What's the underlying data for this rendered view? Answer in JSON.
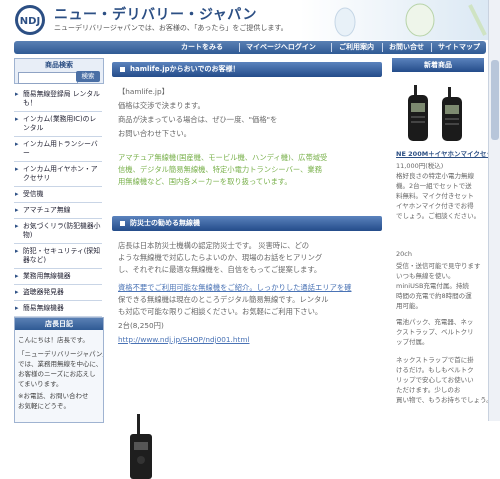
{
  "header": {
    "logo_text": "NDJ",
    "title": "ニュー・デリバリー・ジャパン",
    "tagline": "ニューデリバリージャパンでは、お客様の、「あったら」をご提供します。"
  },
  "nav": [
    "カートをみる",
    "マイページへログイン",
    "ご利用案内",
    "お問い合せ",
    "サイトマップ"
  ],
  "search": {
    "title": "商品検索",
    "button": "検索",
    "placeholder": ""
  },
  "categories": [
    "簡易無線登録局 レンタルも！",
    "インカム(業務用IC)のレンタル",
    "インカム用トランシーバー",
    "インカム用イヤホン・アクセサリ",
    "受信機",
    "アマチュア無線",
    "お気づくリラ(防犯機器小物)",
    "防犯・セキュリティ(探知器など)",
    "業務用無線機器",
    "盗聴器発見器",
    "簡易無線機器"
  ],
  "diary": {
    "title": "店長日記",
    "lines": [
      "こんにちは！店長です。",
      "「ニューデリバリージャパン」",
      "では、業務用無線を中心に、",
      "お客様のニーズにお応えし",
      "てまいります。",
      "※お電話、お問い合わせ",
      "お気軽にどうぞ。"
    ]
  },
  "welcome": {
    "heading": "hamlife.jpからおいでのお客様！",
    "lines": [
      "【hamlife.jp】",
      "価格は交渉で決まります。",
      "商品が決まっている場合は、ぜひ一度、\"価格\"を",
      "お問い合わせ下さい。",
      "アマチュア無線機(国産機、モービル機、ハンディ機)、広帯域受",
      "信機、デジタル簡易無線機、特定小電力トランシーバー、業務",
      "用無線機など、国内各メーカーを取り扱っています。"
    ]
  },
  "disaster": {
    "heading": "防災士の勧める無線機",
    "lines": [
      "店長は日本防災士機構の認定防災士です。 災害時に、どの",
      "ような無線機で対応したらよいのか、現場のお話をヒアリング",
      "し、それぞれに最適な無線機を、自信をもってご提案します。",
      "資格不要でご利用可能な無線機をご紹介。しっかりした通話エリアを確",
      "保できる無線機は現在のところデジタル簡易無線です。レンタル",
      "も対応で可能な限りご相談ください。お気軽にご利用下さい。",
      "2台(8,250円)",
      "http://www.ndj.jp/SHOP/ndj001.html"
    ]
  },
  "new_products": {
    "title": "新着商品",
    "name": "NE 200M＋イヤホンマイクセット",
    "lines": [
      "11,000円(税込)",
      "格好良さの特定小電力無線",
      "機。2台一組でセットで送",
      "料無料。マイク付きセット",
      "イヤホンマイク付きでお得",
      "でしょう。ご相談ください。",
      "",
      "20ch",
      "受信・送信可能で見守ります",
      "いつも無線を使い。",
      "miniUSB充電付属。持続",
      "時間の充電で約8時間の運",
      "用可能。",
      "",
      "電池パック、充電器、ネッ",
      "クストラップ、ベルトクリ",
      "ップ付属。",
      "",
      "ネックストラップで首に掛",
      "けるだけ。もしもベルトク",
      "リップで安心してお使いい",
      "ただけます。少しのお",
      "買い物で、もうお持ちでしょう。"
    ]
  }
}
